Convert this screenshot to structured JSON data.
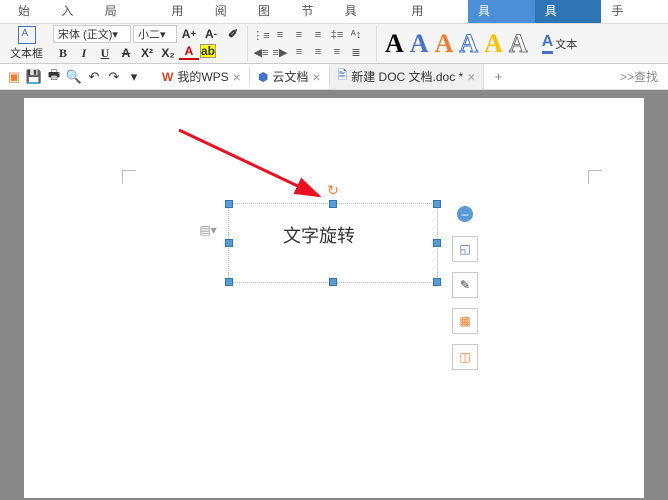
{
  "tabs": [
    "开始",
    "插入",
    "页面布局",
    "引用",
    "审阅",
    "视图",
    "章节",
    "开发工具",
    "特色应用",
    "绘图工具",
    "文本工具",
    "文档助手"
  ],
  "activeTab": 10,
  "ribbon": {
    "textframe_label": "文本框",
    "font_name": "宋体 (正文)",
    "font_size": "小二",
    "wordart_colors": [
      "#000",
      "#4472C4",
      "#ED7D31",
      "#4472C4",
      "#FFC000",
      "#777"
    ],
    "text_tool_label": "文本"
  },
  "doctabs": [
    {
      "icon": "#D24726",
      "label": "我的WPS"
    },
    {
      "icon": "#4472C4",
      "label": "云文档"
    },
    {
      "icon": "#4472C4",
      "label": "新建 DOC 文档.doc *",
      "active": true
    }
  ],
  "search_hint": ">>查找",
  "textbox_text": "文字旋转",
  "side_icons": [
    "↗",
    "✎",
    "▦",
    "◫"
  ]
}
